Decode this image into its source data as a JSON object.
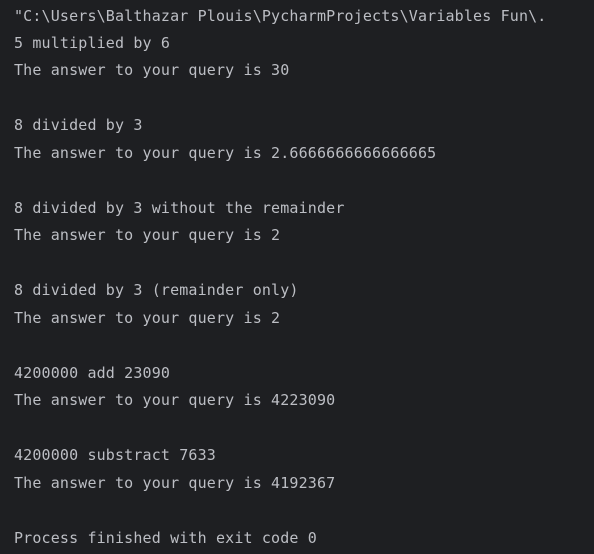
{
  "console": {
    "lines": [
      "\"C:\\Users\\Balthazar Plouis\\PycharmProjects\\Variables Fun\\.",
      "5 multiplied by 6",
      "The answer to your query is 30",
      "",
      "8 divided by 3",
      "The answer to your query is 2.6666666666666665",
      "",
      "8 divided by 3 without the remainder",
      "The answer to your query is 2",
      "",
      "8 divided by 3 (remainder only)",
      "The answer to your query is 2",
      "",
      "4200000 add 23090",
      "The answer to your query is 4223090",
      "",
      "4200000 substract 7633",
      "The answer to your query is 4192367",
      "",
      "Process finished with exit code 0"
    ]
  }
}
